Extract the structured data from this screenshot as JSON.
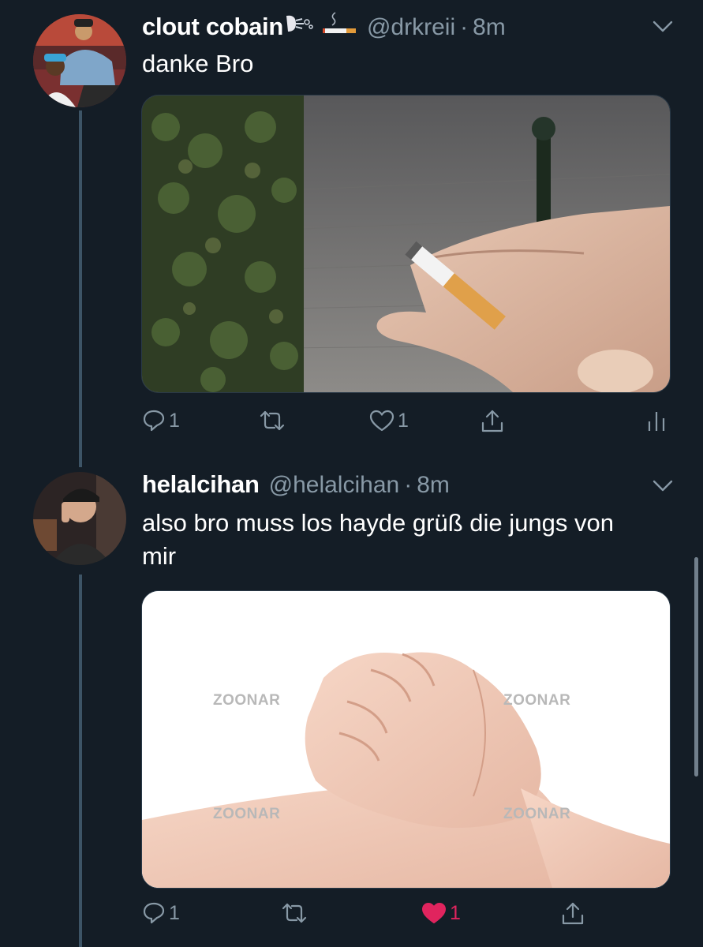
{
  "tweets": [
    {
      "name": "clout cobain",
      "handle": "@drkreii",
      "separator": "·",
      "time": "8m",
      "text": "danke Bro",
      "actions": {
        "replies": "1",
        "retweets": "",
        "likes": "1",
        "liked": false
      },
      "image_icon": "cigarette-photo"
    },
    {
      "name": "helalcihan",
      "handle": "@helalcihan",
      "separator": "·",
      "time": "8m",
      "text": "also bro muss los hayde grüß die jungs von mir",
      "actions": {
        "replies": "1",
        "retweets": "",
        "likes": "1",
        "liked": true
      },
      "image_icon": "handshake-photo",
      "watermarks": [
        "ZOONAR",
        "ZOONAR",
        "ZOONAR",
        "ZOONAR"
      ]
    }
  ],
  "colors": {
    "background": "#141d26",
    "secondary_text": "#8899a6",
    "like_active": "#e0245e",
    "thread_line": "#3d5466"
  }
}
